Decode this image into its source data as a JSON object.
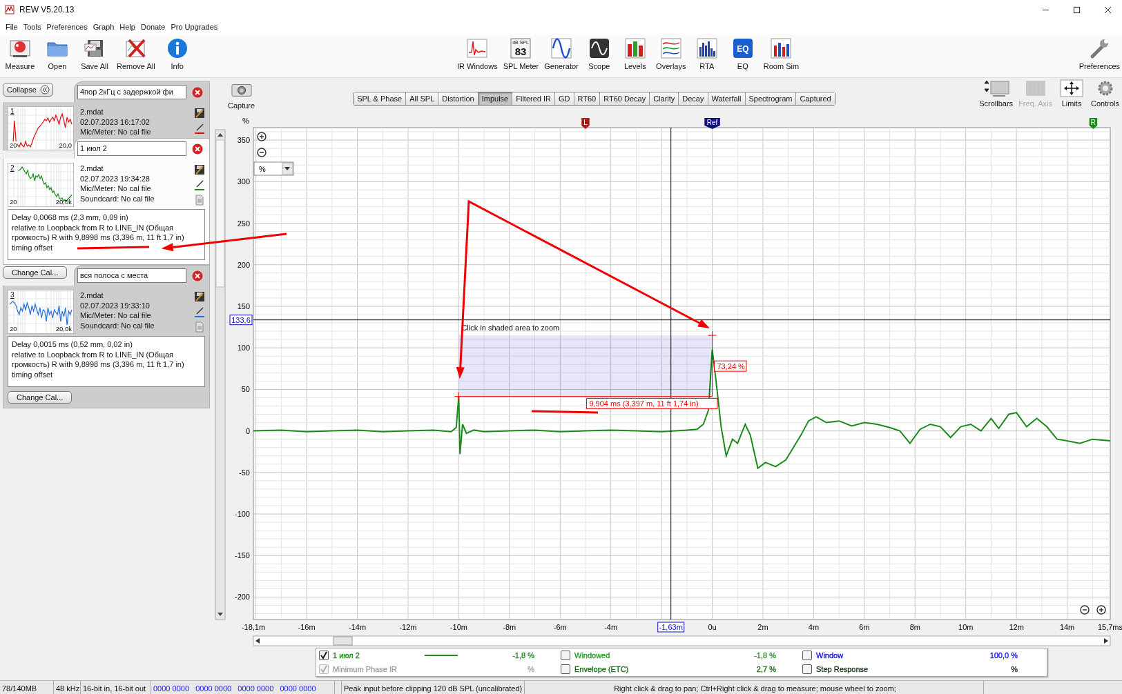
{
  "window": {
    "title": "REW V5.20.13"
  },
  "menu": [
    "File",
    "Tools",
    "Preferences",
    "Graph",
    "Help",
    "Donate",
    "Pro Upgrades"
  ],
  "toolbar_left": [
    {
      "label": "Measure"
    },
    {
      "label": "Open"
    },
    {
      "label": "Save All"
    },
    {
      "label": "Remove All"
    },
    {
      "label": "Info"
    }
  ],
  "toolbar_center": [
    {
      "label": "IR Windows"
    },
    {
      "label": "SPL Meter",
      "badge_top": "dB SPL",
      "badge": "83"
    },
    {
      "label": "Generator"
    },
    {
      "label": "Scope"
    },
    {
      "label": "Levels"
    },
    {
      "label": "Overlays"
    },
    {
      "label": "RTA"
    },
    {
      "label": "EQ",
      "badge": "EQ"
    },
    {
      "label": "Room Sim"
    }
  ],
  "toolbar_right": [
    {
      "label": "Preferences"
    }
  ],
  "collapse_button": "Collapse",
  "measurements": [
    {
      "number": "1",
      "name": "4пор 2кГц с задержкой фи",
      "file": "2.mdat",
      "date": "02.07.2023 16:17:02",
      "mic": "Mic/Meter: No cal file",
      "axis_min": "20",
      "axis_max": "20,0",
      "color": "#e01010",
      "selected": false
    },
    {
      "number": "2",
      "name": "1 июл 2",
      "file": "2.mdat",
      "date": "02.07.2023 19:34:28",
      "mic": "Mic/Meter: No cal file",
      "soundcard": "Soundcard: No cal file",
      "axis_min": "20",
      "axis_max": "20,0k",
      "color": "#1a8a1a",
      "selected": true,
      "delay": "Delay 0,0068 ms (2,3 mm, 0,09 in)\n relative to Loopback from  R to LINE_IN (Общая громкость) R with 9,8998 ms (3,396 m, 11 ft 1,7 in) timing offset",
      "change_cal": "Change Cal..."
    },
    {
      "number": "3",
      "name": "вся полоса с места",
      "file": "2.mdat",
      "date": "02.07.2023 19:33:10",
      "mic": "Mic/Meter: No cal file",
      "soundcard": "Soundcard: No cal file",
      "axis_min": "20",
      "axis_max": "20,0k",
      "color": "#1f6fe0",
      "selected": false,
      "delay": "Delay 0,0015 ms (0,52 mm, 0,02 in)\n relative to Loopback from  R to LINE_IN (Общая громкость) R with 9,8998 ms (3,396 m, 11 ft 1,7 in) timing offset",
      "change_cal": "Change Cal..."
    }
  ],
  "graph": {
    "capture": "Capture",
    "tabs": [
      {
        "label": "SPL & Phase",
        "selected": false
      },
      {
        "label": "All SPL",
        "selected": false
      },
      {
        "label": "Distortion",
        "selected": false
      },
      {
        "label": "Impulse",
        "selected": true
      },
      {
        "label": "Filtered IR",
        "selected": false
      },
      {
        "label": "GD",
        "selected": false
      },
      {
        "label": "RT60",
        "selected": false
      },
      {
        "label": "RT60 Decay",
        "selected": false
      },
      {
        "label": "Clarity",
        "selected": false
      },
      {
        "label": "Decay",
        "selected": false
      },
      {
        "label": "Waterfall",
        "selected": false
      },
      {
        "label": "Spectrogram",
        "selected": false
      },
      {
        "label": "Captured",
        "selected": false
      }
    ],
    "tools": [
      {
        "label": "Scrollbars",
        "disabled": false
      },
      {
        "label": "Freq. Axis",
        "disabled": true
      },
      {
        "label": "Limits",
        "disabled": false
      },
      {
        "label": "Controls",
        "disabled": false
      }
    ],
    "unit_select": "%",
    "cursors": [
      {
        "label": "L",
        "color": "#b01818"
      },
      {
        "label": "Ref",
        "color": "#101080"
      },
      {
        "label": "R",
        "color": "#1a8a1a"
      }
    ],
    "zoom_area": {
      "text": "Click in shaded area to zoom"
    },
    "measure_readouts": [
      "9,904 ms (3,397 m, 11 ft 1,74 in)",
      "73,24 %"
    ],
    "chart_data": {
      "type": "line",
      "ylabel": "%",
      "grid": true,
      "x": [
        -18.1,
        -17,
        -16,
        -15,
        -14,
        -13,
        -12,
        -11,
        -10.3,
        -10.1,
        -10,
        -9.95,
        -9.85,
        -9.7,
        -9.4,
        -9,
        -8,
        -7,
        -6,
        -5,
        -4,
        -3,
        -2,
        -1,
        -0.6,
        -0.35,
        -0.15,
        0,
        0.15,
        0.35,
        0.55,
        0.8,
        1,
        1.3,
        1.5,
        1.8,
        2.1,
        2.5,
        2.9,
        3.2,
        3.5,
        3.8,
        4.1,
        4.5,
        5,
        5.5,
        6,
        6.5,
        7,
        7.4,
        7.8,
        8.2,
        8.6,
        9,
        9.4,
        9.8,
        10.2,
        10.6,
        11,
        11.3,
        11.7,
        12,
        12.4,
        12.8,
        13.2,
        13.6,
        14,
        14.5,
        15,
        15.7
      ],
      "series": [
        {
          "color": "#1a8a1a",
          "values": [
            0,
            1,
            -1,
            0,
            1,
            -1,
            0,
            1,
            -1,
            4,
            42,
            -28,
            8,
            -3,
            1,
            -1,
            0,
            1,
            -1,
            0,
            1,
            0,
            -1,
            1,
            2,
            8,
            25,
            98,
            60,
            5,
            -30,
            -10,
            -15,
            8,
            -5,
            -45,
            -38,
            -43,
            -35,
            -20,
            -5,
            12,
            17,
            10,
            12,
            6,
            10,
            8,
            4,
            0,
            -15,
            2,
            8,
            5,
            -8,
            5,
            8,
            0,
            15,
            3,
            20,
            22,
            5,
            15,
            5,
            -10,
            -12,
            -15,
            -10,
            -12
          ]
        }
      ],
      "xlim": [
        -18.1,
        15.7
      ],
      "ylim": [
        -227,
        365
      ],
      "xticks": [
        {
          "value": -18.1,
          "label": "-18,1m"
        },
        {
          "value": -16,
          "label": "-16m"
        },
        {
          "value": -14,
          "label": "-14m"
        },
        {
          "value": -12,
          "label": "-12m"
        },
        {
          "value": -10,
          "label": "-10m"
        },
        {
          "value": -8,
          "label": "-8m"
        },
        {
          "value": -6,
          "label": "-6m"
        },
        {
          "value": -4,
          "label": "-4m"
        },
        {
          "value": 0,
          "label": "0u"
        },
        {
          "value": 2,
          "label": "2m"
        },
        {
          "value": 4,
          "label": "4m"
        },
        {
          "value": 6,
          "label": "6m"
        },
        {
          "value": 8,
          "label": "8m"
        },
        {
          "value": 10,
          "label": "10m"
        },
        {
          "value": 12,
          "label": "12m"
        },
        {
          "value": 14,
          "label": "14m"
        },
        {
          "value": 15.7,
          "label": "15,7ms"
        }
      ],
      "yticks": [
        350,
        300,
        250,
        200,
        150,
        100,
        50,
        0,
        -50,
        -100,
        -150,
        -200
      ],
      "ref_lines": [
        {
          "axis": "x",
          "value": -1.63,
          "label": "-1,63m"
        },
        {
          "axis": "y",
          "value": 133.6,
          "label": "133,6"
        }
      ]
    }
  },
  "legend": [
    {
      "kind": "series",
      "label": "1 июл 2",
      "value": "-1,8 %",
      "checked": true,
      "disabled": false,
      "color": "#1a8a1a"
    },
    {
      "kind": "option",
      "label": "Windowed",
      "value": "-1,8 %",
      "checked": false,
      "disabled": false,
      "color": "#2a9a2a"
    },
    {
      "kind": "option",
      "label": "Window",
      "value": "100,0 %",
      "checked": false,
      "disabled": false,
      "color": "#1515e0"
    },
    {
      "kind": "option",
      "label": "Minimum Phase IR",
      "value": "%",
      "checked": true,
      "disabled": true,
      "color": "#a0a0a0"
    },
    {
      "kind": "option",
      "label": "Envelope (ETC)",
      "value": "2,7 %",
      "checked": false,
      "disabled": false,
      "color": "#1e6a1e"
    },
    {
      "kind": "option",
      "label": "Step Response",
      "value": "%",
      "checked": false,
      "disabled": false,
      "color": "#203820"
    }
  ],
  "status_bar": [
    {
      "text": "78/140MB",
      "kind": "plain"
    },
    {
      "text": "48 kHz",
      "kind": "plain"
    },
    {
      "text": "16-bit in, 16-bit out",
      "kind": "plain"
    },
    {
      "text": "0000 0000   0000 0000   0000 0000   0000 0000",
      "kind": "digits"
    },
    {
      "text": "Peak input before clipping 120 dB SPL (uncalibrated)",
      "kind": "plain"
    },
    {
      "text": "Right click & drag to pan; Ctrl+Right click & drag to measure; mouse wheel to zoom;",
      "kind": "hint"
    }
  ]
}
